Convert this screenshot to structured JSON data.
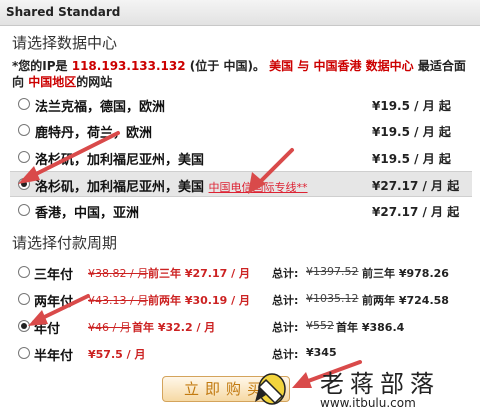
{
  "window": {
    "title": "Shared Standard"
  },
  "datacenter": {
    "heading": "请选择数据中心",
    "notice_prefix": "*您的IP是",
    "ip": "118.193.133.132",
    "ip_location": "(位于 中国)。",
    "recommend": "美国 与 中国香港 数据中心",
    "recommend_suffix": "最适合面向",
    "region": "中国地区",
    "region_suffix": "的网站",
    "options": [
      {
        "name": "法兰克福，德国，欧洲",
        "price": "¥19.5 / 月 起",
        "selected": false,
        "link": ""
      },
      {
        "name": "鹿特丹，荷兰，欧洲",
        "price": "¥19.5 / 月 起",
        "selected": false,
        "link": ""
      },
      {
        "name": "洛杉矶，加利福尼亚州，美国",
        "price": "¥19.5 / 月 起",
        "selected": false,
        "link": ""
      },
      {
        "name": "洛杉矶，加利福尼亚州，美国",
        "price": "¥27.17 / 月 起",
        "selected": true,
        "link": "中国电信国际专线**"
      },
      {
        "name": "香港，中国，亚洲",
        "price": "¥27.17 / 月 起",
        "selected": false,
        "link": ""
      }
    ]
  },
  "payment": {
    "heading": "请选择付款周期",
    "total_label": "总计:",
    "options": [
      {
        "name": "三年付",
        "orig": "¥38.82 / 月",
        "disc": "前三年 ¥27.17 / 月",
        "total_orig": "¥1397.52",
        "total_disc": "前三年 ¥978.26",
        "selected": false
      },
      {
        "name": "两年付",
        "orig": "¥43.13 / 月",
        "disc": "前两年 ¥30.19 / 月",
        "total_orig": "¥1035.12",
        "total_disc": "前两年 ¥724.58",
        "selected": false
      },
      {
        "name": "年付",
        "orig": "¥46 / 月",
        "disc": "首年 ¥32.2 / 月",
        "total_orig": "¥552",
        "total_disc": "首年 ¥386.4",
        "selected": true
      },
      {
        "name": "半年付",
        "orig": "",
        "disc": "¥57.5 / 月",
        "total_orig": "",
        "total_disc": "¥345",
        "selected": false
      }
    ]
  },
  "buy_button": "立即购买",
  "watermark": {
    "title": "老蒋部落",
    "url": "www.itbulu.com"
  },
  "colors": {
    "accent_red": "#cc0000",
    "arrow": "#d94a4a",
    "button_text": "#c27a10"
  }
}
